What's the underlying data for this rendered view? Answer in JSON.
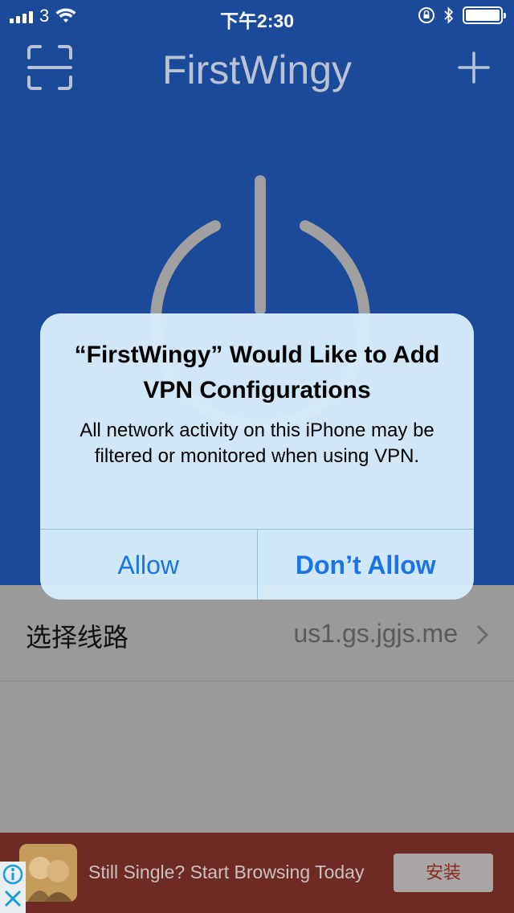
{
  "status_bar": {
    "carrier": "3",
    "time": "下午2:30"
  },
  "nav": {
    "title": "FirstWingy"
  },
  "route_row": {
    "label": "选择线路",
    "value": "us1.gs.jgjs.me"
  },
  "alert": {
    "title": "“FirstWingy” Would Like to Add VPN Configurations",
    "message": "All network activity on this iPhone may be filtered or monitored when using VPN.",
    "allow_label": "Allow",
    "deny_label": "Don’t Allow"
  },
  "ad": {
    "text": "Still Single? Start Browsing Today",
    "button_label": "安装"
  },
  "colors": {
    "nav_blue": "#1c4a9a",
    "alert_button_blue": "#1a73e8",
    "ad_background": "#6e2a24"
  },
  "icons": [
    "signal-icon",
    "wifi-icon",
    "lock-rotation-icon",
    "bluetooth-icon",
    "battery-icon",
    "scan-icon",
    "plus-icon",
    "power-icon",
    "chevron-right-icon",
    "ad-info-icon",
    "ad-close-icon"
  ]
}
